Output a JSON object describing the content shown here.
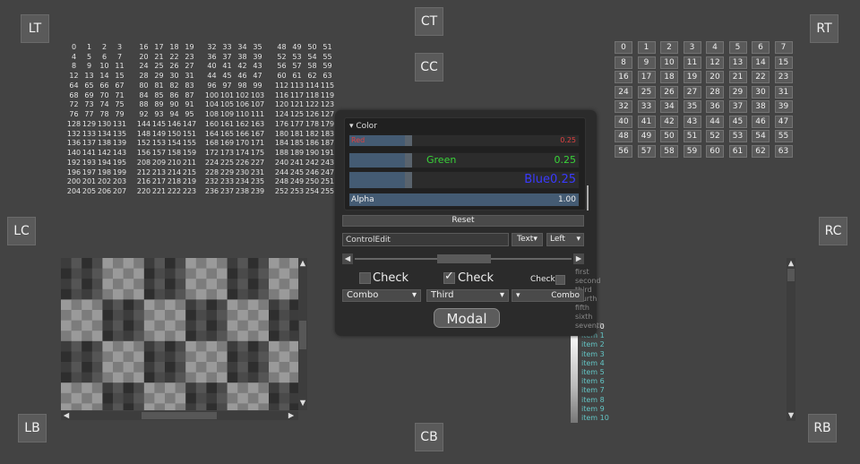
{
  "anchors": {
    "lt": "LT",
    "ct": "CT",
    "cc": "CC",
    "rt": "RT",
    "lc": "LC",
    "rc": "RC",
    "lb": "LB",
    "cb": "CB",
    "rb": "RB"
  },
  "number_blocks_max": 255,
  "right_grid_cells": [
    "0",
    "1",
    "2",
    "3",
    "4",
    "5",
    "6",
    "7",
    "8",
    "9",
    "10",
    "11",
    "12",
    "13",
    "14",
    "15",
    "16",
    "17",
    "18",
    "19",
    "20",
    "21",
    "22",
    "23",
    "24",
    "25",
    "26",
    "27",
    "28",
    "29",
    "30",
    "31",
    "32",
    "33",
    "34",
    "35",
    "36",
    "37",
    "38",
    "39",
    "40",
    "41",
    "42",
    "43",
    "44",
    "45",
    "46",
    "47",
    "48",
    "49",
    "50",
    "51",
    "52",
    "53",
    "54",
    "55",
    "56",
    "57",
    "58",
    "59",
    "60",
    "61",
    "62",
    "63"
  ],
  "panel": {
    "section_title": "Color",
    "red_label": "Red",
    "red_value": "0.25",
    "green_label": "Green",
    "green_value": "0.25",
    "blue_label": "Blue",
    "blue_value": "0.25",
    "alpha_label": "Alpha",
    "alpha_value": "1.00",
    "reset_label": "Reset",
    "edit_value": "ControlEdit",
    "text_dropdown": "Text",
    "left_dropdown": "Left",
    "check1_label": "Check",
    "check2_label": "Check",
    "check3_label": "Check",
    "combo1": "Combo",
    "combo2": "Third",
    "combo3": "Combo",
    "modal_label": "Modal",
    "popup_items": [
      "first",
      "second",
      "third",
      "fourth",
      "fifth",
      "sixth",
      "seventh"
    ]
  },
  "list_items": [
    "item 0",
    "item 1",
    "item 2",
    "item 3",
    "item 4",
    "item 5",
    "item 6",
    "item 7",
    "item 8",
    "item 9",
    "item 10"
  ],
  "colors": {
    "background": "#434343",
    "panel": "#2b2b2b",
    "green_text": "#39d439",
    "blue_text": "#3a3aff",
    "red_text": "#e04040",
    "list_text": "#63c4c4"
  }
}
